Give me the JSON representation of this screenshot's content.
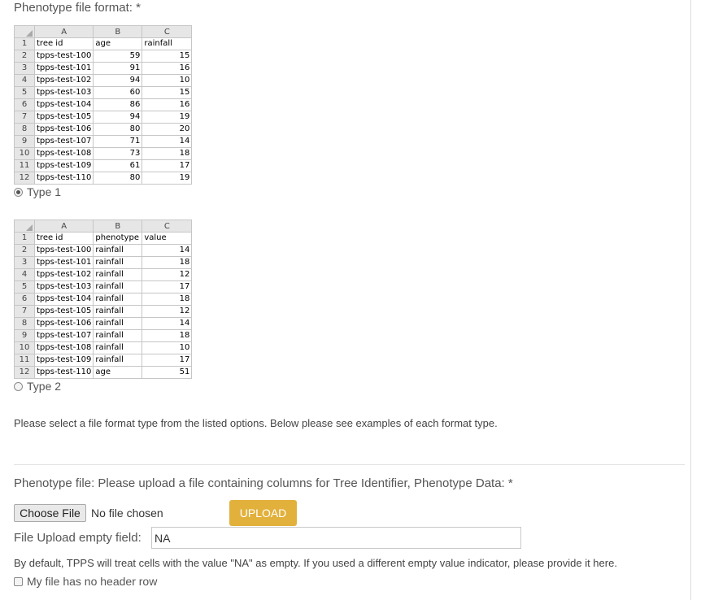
{
  "format": {
    "label": "Phenotype file format: *",
    "option1_label": "Type 1",
    "option2_label": "Type 2",
    "description": "Please select a file format type from the listed options. Below please see examples of each format type."
  },
  "example_type1": {
    "col_headers": [
      "A",
      "B",
      "C"
    ],
    "rows": [
      [
        "1",
        "tree id",
        "age",
        "rainfall"
      ],
      [
        "2",
        "tpps-test-100",
        "59",
        "15"
      ],
      [
        "3",
        "tpps-test-101",
        "91",
        "16"
      ],
      [
        "4",
        "tpps-test-102",
        "94",
        "10"
      ],
      [
        "5",
        "tpps-test-103",
        "60",
        "15"
      ],
      [
        "6",
        "tpps-test-104",
        "86",
        "16"
      ],
      [
        "7",
        "tpps-test-105",
        "94",
        "19"
      ],
      [
        "8",
        "tpps-test-106",
        "80",
        "20"
      ],
      [
        "9",
        "tpps-test-107",
        "71",
        "14"
      ],
      [
        "10",
        "tpps-test-108",
        "73",
        "18"
      ],
      [
        "11",
        "tpps-test-109",
        "61",
        "17"
      ],
      [
        "12",
        "tpps-test-110",
        "80",
        "19"
      ]
    ]
  },
  "example_type2": {
    "col_headers": [
      "A",
      "B",
      "C"
    ],
    "rows": [
      [
        "1",
        "tree id",
        "phenotype",
        "value"
      ],
      [
        "2",
        "tpps-test-100",
        "rainfall",
        "14"
      ],
      [
        "3",
        "tpps-test-101",
        "rainfall",
        "18"
      ],
      [
        "4",
        "tpps-test-102",
        "rainfall",
        "12"
      ],
      [
        "5",
        "tpps-test-103",
        "rainfall",
        "17"
      ],
      [
        "6",
        "tpps-test-104",
        "rainfall",
        "18"
      ],
      [
        "7",
        "tpps-test-105",
        "rainfall",
        "12"
      ],
      [
        "8",
        "tpps-test-106",
        "rainfall",
        "14"
      ],
      [
        "9",
        "tpps-test-107",
        "rainfall",
        "18"
      ],
      [
        "10",
        "tpps-test-108",
        "rainfall",
        "10"
      ],
      [
        "11",
        "tpps-test-109",
        "rainfall",
        "17"
      ],
      [
        "12",
        "tpps-test-110",
        "age",
        "51"
      ]
    ]
  },
  "upload": {
    "label": "Phenotype file: Please upload a file containing columns for Tree Identifier, Phenotype Data: *",
    "choose_label": "Choose File",
    "no_file_text": "No file chosen",
    "upload_label": "UPLOAD"
  },
  "empty_field": {
    "label": "File Upload empty field:",
    "value": "NA",
    "help": "By default, TPPS will treat cells with the value \"NA\" as empty. If you used a different empty value indicator, please provide it here."
  },
  "no_header": {
    "label": "My file has no header row",
    "checked": false
  },
  "colors": {
    "upload_button": "#e2b13c",
    "sheet_header": "#e6e6e6"
  }
}
